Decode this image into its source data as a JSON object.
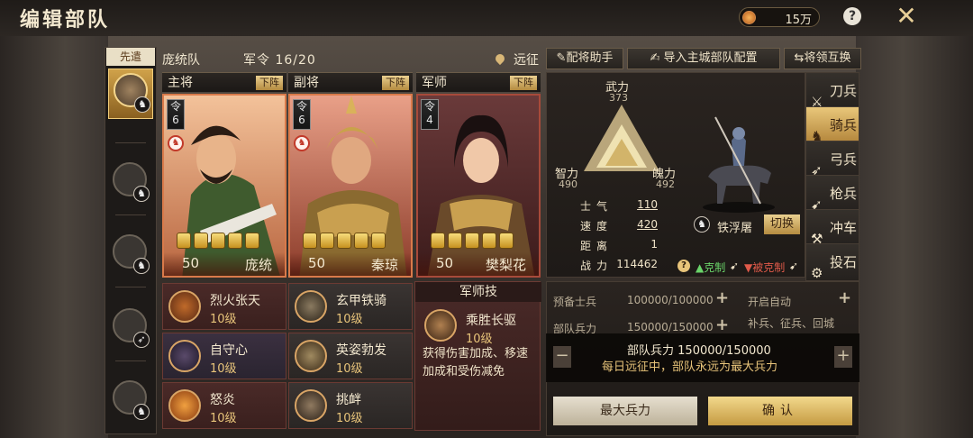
{
  "header": {
    "title": "编辑部队",
    "currency": "15万"
  },
  "sidebar": {
    "vanguard_label": "先遣"
  },
  "troop": {
    "name": "庞统队",
    "order_label": "军令",
    "order_value": "16/20",
    "expedition": "远征"
  },
  "toolbar": {
    "assist": "配将助手",
    "import": "导入主城部队配置",
    "swap": "将领互换"
  },
  "columns": [
    {
      "role": "主将",
      "down": "下阵",
      "ling": "令",
      "ling_num": "6",
      "level": "50",
      "name": "庞统"
    },
    {
      "role": "副将",
      "down": "下阵",
      "ling": "令",
      "ling_num": "6",
      "level": "50",
      "name": "秦琼"
    },
    {
      "role": "军师",
      "down": "下阵",
      "ling": "令",
      "ling_num": "4",
      "level": "50",
      "name": "樊梨花"
    }
  ],
  "skills": {
    "col1": [
      {
        "name": "烈火张天",
        "level": "10级"
      },
      {
        "name": "自守心",
        "level": "10级"
      },
      {
        "name": "怒炎",
        "level": "10级"
      }
    ],
    "col2": [
      {
        "name": "玄甲铁骑",
        "level": "10级"
      },
      {
        "name": "英姿勃发",
        "level": "10级"
      },
      {
        "name": "挑衅",
        "level": "10级"
      }
    ],
    "strategist": {
      "title": "军师技",
      "name": "乘胜长驱",
      "level": "10级",
      "desc": "获得伤害加成、移速加成和受伤减免"
    }
  },
  "stats": {
    "wuli": "武力",
    "wuli_v": "373",
    "zhili": "智力",
    "zhili_v": "490",
    "poli": "魄力",
    "poli_v": "492",
    "rows": [
      {
        "label": "士气",
        "value": "110"
      },
      {
        "label": "速度",
        "value": "420"
      },
      {
        "label": "距离",
        "value": "1"
      },
      {
        "label": "战力",
        "value": "114462"
      }
    ],
    "unit_name": "铁浮屠",
    "switch": "切换",
    "counter": "克制",
    "countered": "被克制"
  },
  "unit_tabs": [
    "刀兵",
    "骑兵",
    "弓兵",
    "枪兵",
    "冲车",
    "投石"
  ],
  "lower": {
    "reserve_label": "预备士兵",
    "reserve_value": "100000/100000",
    "troops_label": "部队兵力",
    "troops_value": "150000/150000",
    "auto_label": "开启自动",
    "auto_desc": "补兵、征兵、回城",
    "tip_line1_label": "部队兵力",
    "tip_line1_value": "150000/150000",
    "tip_line2": "每日远征中，部队永远为最大兵力",
    "btn_max": "最大兵力",
    "btn_ok": "确认"
  }
}
